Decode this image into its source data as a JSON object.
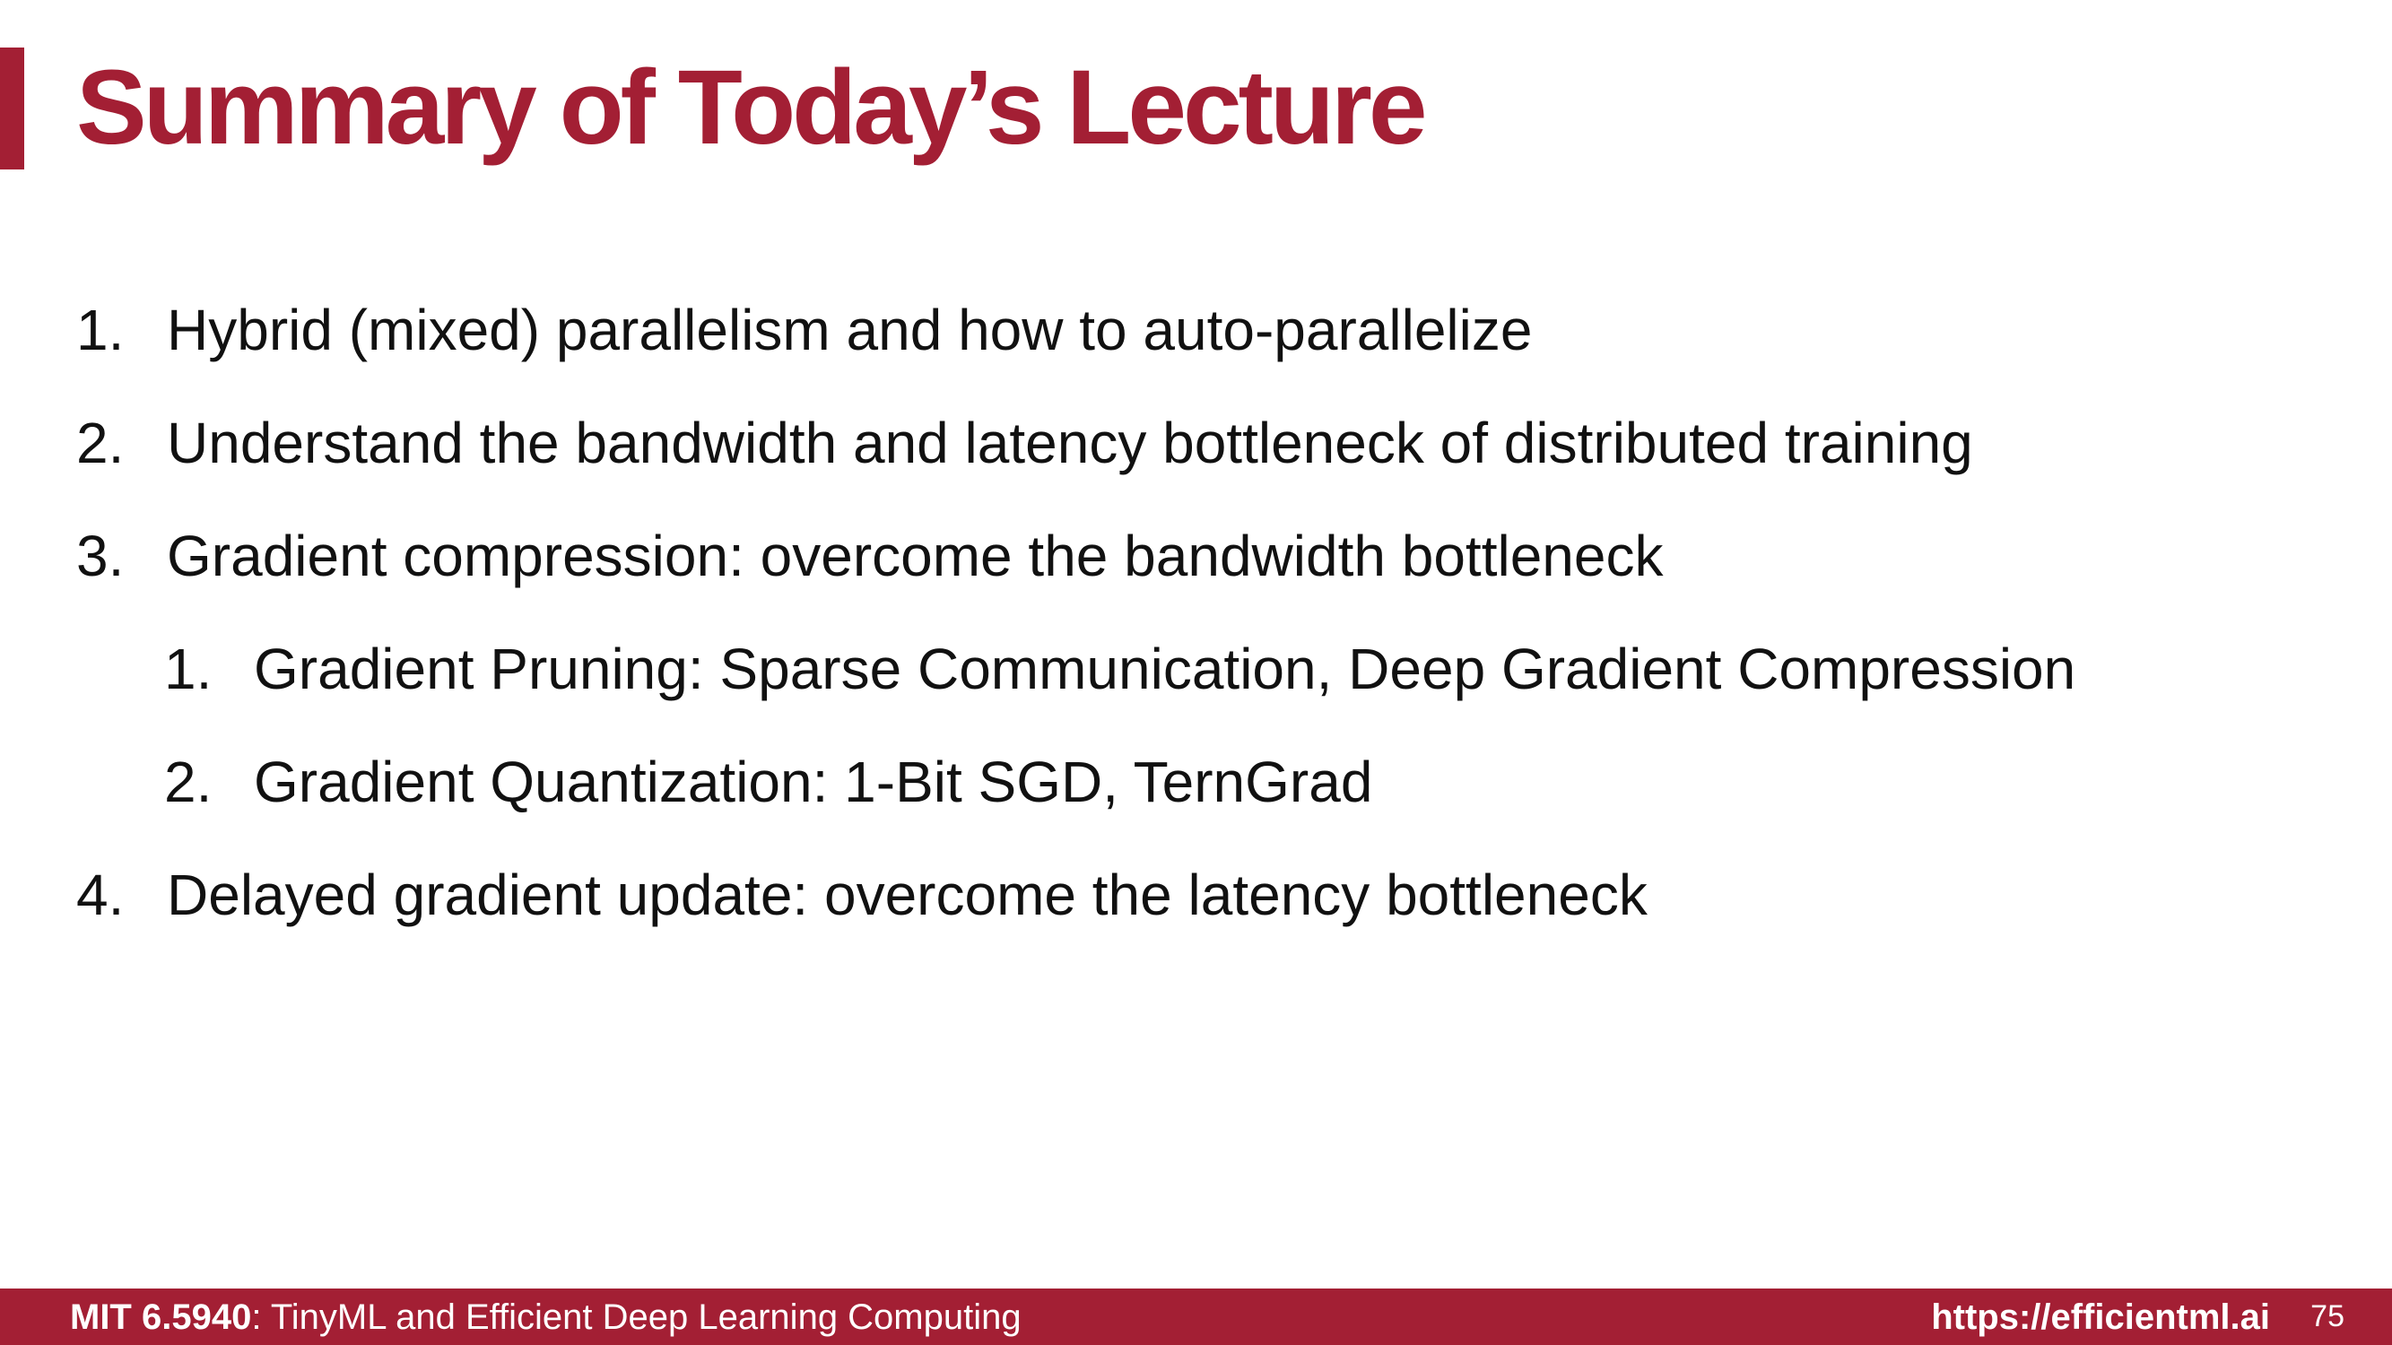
{
  "slide": {
    "title": "Summary of Today’s Lecture",
    "items": [
      {
        "num": "1.",
        "text": "Hybrid (mixed) parallelism and how to auto-parallelize"
      },
      {
        "num": "2.",
        "text": "Understand the bandwidth and latency bottleneck of distributed training"
      },
      {
        "num": "3.",
        "text": "Gradient compression: overcome the bandwidth bottleneck"
      },
      {
        "num": "1.",
        "text": "Gradient Pruning: Sparse Communication, Deep Gradient Compression"
      },
      {
        "num": "2.",
        "text": "Gradient Quantization: 1-Bit SGD, TernGrad"
      },
      {
        "num": "4.",
        "text": "Delayed gradient update: overcome the latency bottleneck"
      }
    ]
  },
  "footer": {
    "course_code": "MIT 6.5940",
    "course_name": ": TinyML and Efficient Deep Learning Computing",
    "url": "https://efficientml.ai",
    "page_number": "75"
  },
  "colors": {
    "accent": "#a31f34",
    "text": "#111111",
    "background": "#ffffff"
  }
}
